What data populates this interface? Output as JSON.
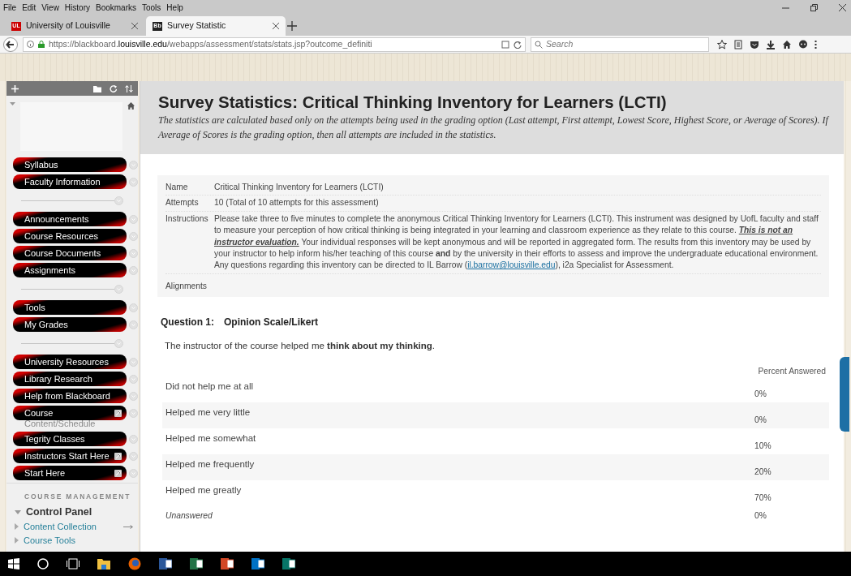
{
  "menu_bar": [
    "File",
    "Edit",
    "View",
    "History",
    "Bookmarks",
    "Tools",
    "Help"
  ],
  "tabs": [
    {
      "label": "University of Louisville",
      "favicon_text": "UL",
      "selected": false
    },
    {
      "label": "Survey Statistic",
      "favicon_text": "Bb",
      "selected": true
    }
  ],
  "address_bar": {
    "url_prefix": "https://blackboard.",
    "url_domain": "louisville.edu",
    "url_path": "/webapps/assessment/stats/stats.jsp?outcome_definiti"
  },
  "search": {
    "placeholder": "Search"
  },
  "sidebar": {
    "items": [
      {
        "kind": "link",
        "label": "Syllabus"
      },
      {
        "kind": "link",
        "label": "Faculty Information"
      },
      {
        "kind": "divider"
      },
      {
        "kind": "link",
        "label": "Announcements"
      },
      {
        "kind": "link",
        "label": "Course Resources"
      },
      {
        "kind": "link",
        "label": "Course Documents"
      },
      {
        "kind": "link",
        "label": "Assignments"
      },
      {
        "kind": "divider"
      },
      {
        "kind": "link",
        "label": "Tools"
      },
      {
        "kind": "link",
        "label": "My Grades"
      },
      {
        "kind": "divider"
      },
      {
        "kind": "link",
        "label": "University Resources"
      },
      {
        "kind": "link",
        "label": "Library Research"
      },
      {
        "kind": "link",
        "label": "Help from Blackboard"
      },
      {
        "kind": "link",
        "label": "Course",
        "label_overflow": "Content/Schedule",
        "external": true
      },
      {
        "kind": "link",
        "label": "Tegrity Classes"
      },
      {
        "kind": "link",
        "label": "Instructors Start Here",
        "external": true
      },
      {
        "kind": "link",
        "label": "Start Here",
        "external": true
      }
    ],
    "management": {
      "heading": "COURSE MANAGEMENT",
      "panel": {
        "label": "Control Panel",
        "expanded": true,
        "children": [
          {
            "label": "Content Collection",
            "expanded": false,
            "arrow": true
          },
          {
            "label": "Course Tools",
            "expanded": false,
            "arrow": false
          }
        ]
      }
    }
  },
  "page": {
    "title": "Survey Statistics: Critical Thinking Inventory for Learners (LCTI)",
    "description": "The statistics are calculated based only on the attempts being used in the grading option (Last attempt, First attempt, Lowest Score, Highest Score, or Average of Scores). If Average of Scores is the grading option, then all attempts are included in the statistics.",
    "details": [
      {
        "label": "Name",
        "value": "Critical Thinking Inventory for Learners (LCTI)"
      },
      {
        "label": "Attempts",
        "value": "10 (Total of 10 attempts for this assessment)"
      },
      {
        "label": "Instructions",
        "segments": [
          {
            "kind": "text",
            "text": "Please take three to five minutes to complete the anonymous Critical Thinking Inventory for Learners (LCTI).  This instrument was designed by UofL faculty and staff to measure your perception of how critical thinking is being integrated in your learning and classroom experience as they relate to this course. "
          },
          {
            "kind": "emphasis",
            "text": "This is not an instructor evaluation."
          },
          {
            "kind": "text",
            "text": "  Your individual responses will be kept anonymous and will be reported in aggregated form. The results from this inventory may be used by your instructor to help inform his/her teaching of this course **and** by the university in their efforts to assess and improve the undergraduate educational environment.  Any questions regarding this inventory can be directed to IL Barrow ("
          },
          {
            "kind": "link",
            "text": "il.barrow@louisville.edu"
          },
          {
            "kind": "text",
            "text": "), i2a Specialist for Assessment."
          }
        ]
      },
      {
        "label": "Alignments"
      }
    ],
    "question": {
      "number": "Question 1:",
      "type": "Opinion Scale/Likert",
      "prompt": "The instructor of the course helped me **think about my thinking**.",
      "column_header": "Percent Answered",
      "answers": [
        {
          "kind": "answer",
          "label": "Did not help me at all",
          "percent": "0%"
        },
        {
          "kind": "answer",
          "label": "Helped me very little",
          "percent": "0%"
        },
        {
          "kind": "answer",
          "label": "Helped me somewhat",
          "percent": "10%"
        },
        {
          "kind": "answer",
          "label": "Helped me frequently",
          "percent": "20%"
        },
        {
          "kind": "answer",
          "label": "Helped me greatly",
          "percent": "70%"
        },
        {
          "kind": "unanswered",
          "label": "Unanswered",
          "percent": "0%"
        }
      ]
    }
  }
}
